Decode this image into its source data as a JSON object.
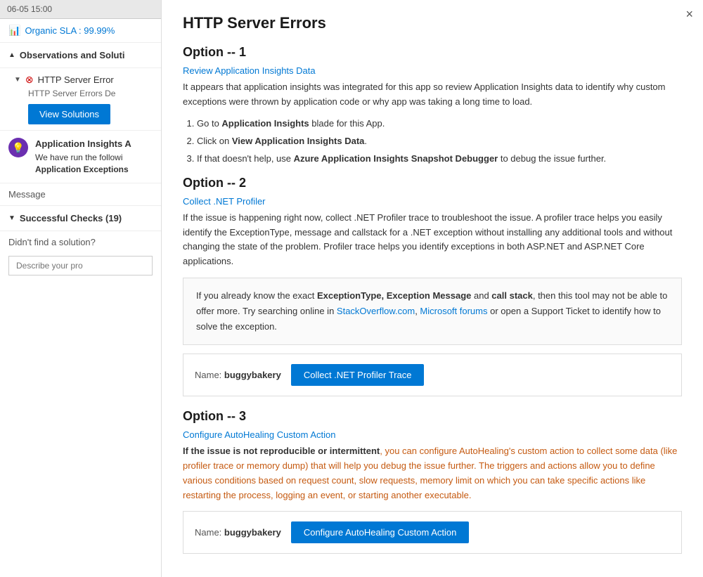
{
  "left": {
    "topbar": "06-05 15:00",
    "sla_label": "Organic SLA : 99.99%",
    "observations_label": "Observations and Soluti",
    "error_item": {
      "title": "HTTP Server Error",
      "desc": "HTTP Server Errors De",
      "view_solutions_btn": "View Solutions"
    },
    "insight": {
      "title": "Application Insights A",
      "desc": "We have run the followi",
      "sub": "Application Exceptions"
    },
    "message_label": "Message",
    "success_checks": "Successful Checks (19)",
    "didnt_find": "Didn't find a solution?",
    "describe_placeholder": "Describe your pro"
  },
  "right": {
    "close_icon": "×",
    "main_title": "HTTP Server Errors",
    "option1": {
      "title": "Option -- 1",
      "subtitle": "Review Application Insights Data",
      "desc": "It appears that application insights was integrated for this app so review Application Insights data to identify why custom exceptions were thrown by application code or why app was taking a long time to load.",
      "steps": [
        {
          "text": "Go to ",
          "bold": "Application Insights",
          "rest": " blade for this App."
        },
        {
          "text": "Click on ",
          "bold": "View Application Insights Data",
          "rest": "."
        },
        {
          "text": "If that doesn't help, use ",
          "bold": "Azure Application Insights Snapshot Debugger",
          "rest": " to debug the issue further."
        }
      ]
    },
    "option2": {
      "title": "Option -- 2",
      "subtitle": "Collect .NET Profiler",
      "desc": "If the issue is happening right now, collect .NET Profiler trace to troubleshoot the issue. A profiler trace helps you easily identify the ExceptionType, message and callstack for a .NET exception without installing any additional tools and without changing the state of the problem. Profiler trace helps you identify exceptions in both ASP.NET and ASP.NET Core applications.",
      "callout_plain1": "If you already know the exact ",
      "callout_bold1": "ExceptionType, Exception Message",
      "callout_plain2": " and ",
      "callout_bold2": "call stack",
      "callout_plain3": ", then this tool may not be able to offer more. Try searching online in ",
      "callout_link1": "StackOverflow.com",
      "callout_plain4": ", ",
      "callout_link2": "Microsoft forums",
      "callout_plain5": " or open a Support Ticket to identify how to solve the exception.",
      "action_name_label": "Name:",
      "action_name_value": "buggybakery",
      "action_btn": "Collect .NET Profiler Trace"
    },
    "option3": {
      "title": "Option -- 3",
      "subtitle": "Configure AutoHealing Custom Action",
      "desc_bold": "If the issue is not reproducible or intermittent",
      "desc_plain1": ", you can configure AutoHealing's custom action to collect some data (like profiler trace or memory dump) that will help you debug the issue further. The triggers and actions allow you to define various conditions based on request count, slow requests, memory limit on which you can take specific actions like restarting the process, logging an event, or starting another executable.",
      "action_name_label": "Name:",
      "action_name_value": "buggybakery",
      "action_btn": "Configure AutoHealing Custom Action"
    }
  }
}
